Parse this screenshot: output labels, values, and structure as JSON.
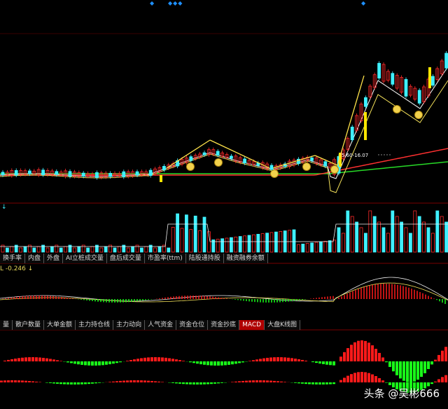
{
  "top_indicators": [
    "◆",
    "◆◆◆",
    "◆"
  ],
  "price_label": "5.60-16.07",
  "volume_tabs": [
    "换手率",
    "内盘",
    "外盘",
    "AI立桩成交量",
    "盘后成交量",
    "市盈率(ttm)",
    "陆股通持股",
    "融资融券余额"
  ],
  "macd_readout": "L -0.246 ↓",
  "indicator_tabs": [
    "量",
    "散户数量",
    "大单金额",
    "主力持仓线",
    "主力动向",
    "人气资金",
    "资金仓位",
    "资金抄底",
    "MACD",
    "大盘K线图"
  ],
  "active_indicator": "MACD",
  "watermark": "头条 @吴彬666",
  "colors": {
    "up": "#ff2a2a",
    "down": "#3ff0ff",
    "ma_short": "#ffffff",
    "ma_mid": "#f5e25a",
    "ma_long": "#ff3030",
    "ma_green": "#27d927",
    "arrow": "#ffe34a",
    "macd_up": "#ff1a1a",
    "macd_down": "#19ff19"
  }
}
